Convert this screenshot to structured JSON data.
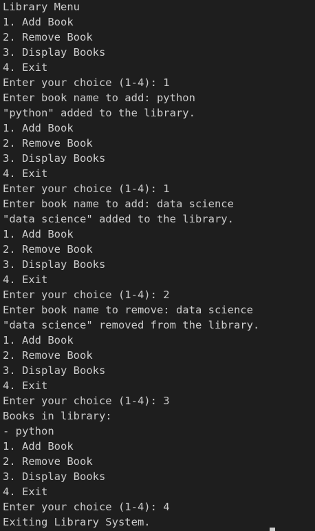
{
  "terminal": {
    "lines": [
      "Library Menu",
      "1. Add Book",
      "2. Remove Book",
      "3. Display Books",
      "4. Exit",
      "Enter your choice (1-4): 1",
      "Enter book name to add: python",
      "\"python\" added to the library.",
      "1. Add Book",
      "2. Remove Book",
      "3. Display Books",
      "4. Exit",
      "Enter your choice (1-4): 1",
      "Enter book name to add: data science",
      "\"data science\" added to the library.",
      "1. Add Book",
      "2. Remove Book",
      "3. Display Books",
      "4. Exit",
      "Enter your choice (1-4): 2",
      "Enter book name to remove: data science",
      "\"data science\" removed from the library.",
      "1. Add Book",
      "2. Remove Book",
      "3. Display Books",
      "4. Exit",
      "Enter your choice (1-4): 3",
      "Books in library:",
      "- python",
      "1. Add Book",
      "2. Remove Book",
      "3. Display Books",
      "4. Exit",
      "Enter your choice (1-4): 4",
      "Exiting Library System."
    ]
  }
}
